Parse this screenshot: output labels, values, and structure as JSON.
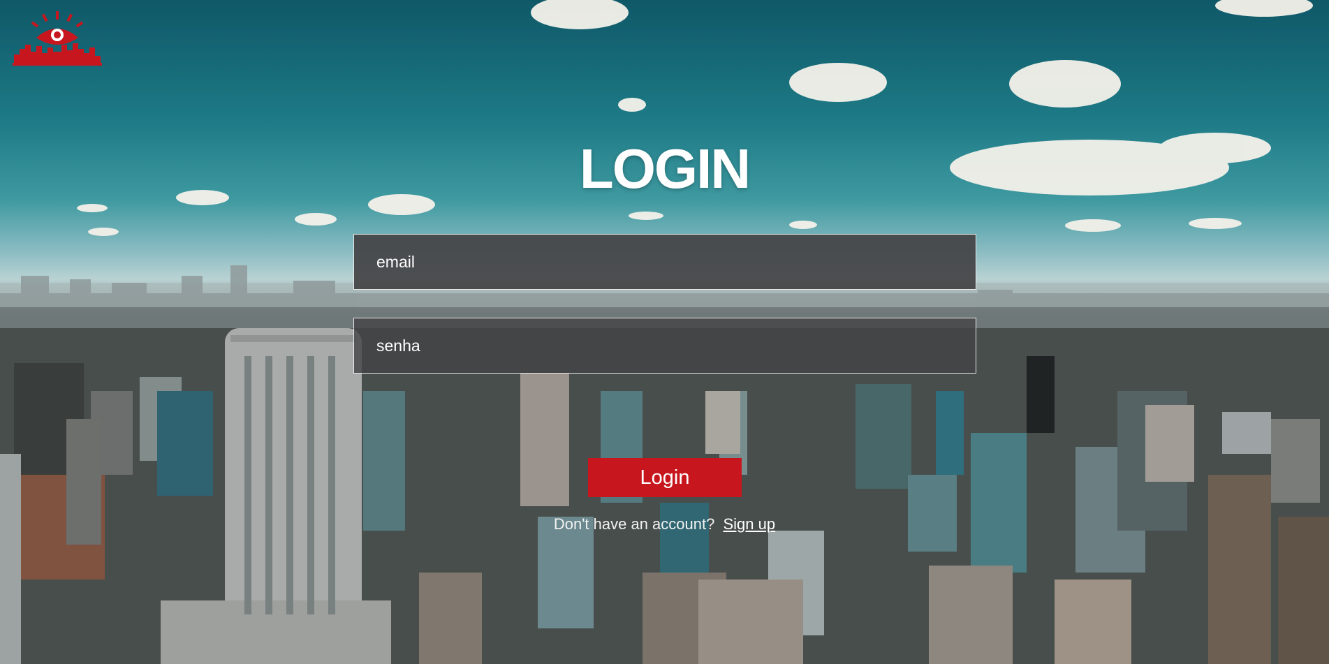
{
  "logo": {
    "icon": "city-eye-logo-icon",
    "color": "#c8161e"
  },
  "title": "LOGIN",
  "form": {
    "email_placeholder": "email",
    "password_placeholder": "senha",
    "login_label": "Login"
  },
  "signup": {
    "prompt": "Don't have an account?",
    "link_label": "Sign up"
  },
  "colors": {
    "accent": "#c8161e",
    "field_bg": "#444446",
    "text": "#ffffff"
  }
}
